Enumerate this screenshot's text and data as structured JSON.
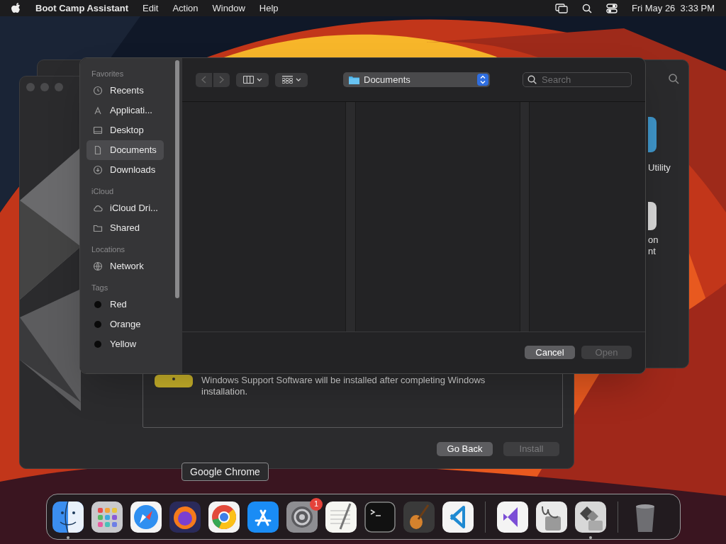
{
  "menu_bar": {
    "app_name": "Boot Camp Assistant",
    "menus": [
      "Edit",
      "Action",
      "Window",
      "Help"
    ],
    "clock": "Fri May 26  3:33 PM"
  },
  "back_window": {
    "labels": [
      "Utility",
      "on",
      "nt"
    ]
  },
  "boot_camp": {
    "message": "Windows Support Software will be installed after completing Windows installation.",
    "buttons": [
      {
        "label": "Go Back",
        "disabled": false
      },
      {
        "label": "Install",
        "disabled": true
      }
    ]
  },
  "open_dialog": {
    "sidebar": [
      {
        "title": "Favorites",
        "items": [
          {
            "label": "Recents",
            "kind": "clock",
            "selected": false
          },
          {
            "label": "Applicati...",
            "kind": "apps",
            "selected": false
          },
          {
            "label": "Desktop",
            "kind": "desktop",
            "selected": false
          },
          {
            "label": "Documents",
            "kind": "doc",
            "selected": true
          },
          {
            "label": "Downloads",
            "kind": "download",
            "selected": false
          }
        ]
      },
      {
        "title": "iCloud",
        "items": [
          {
            "label": "iCloud Dri...",
            "kind": "cloud",
            "selected": false
          },
          {
            "label": "Shared",
            "kind": "shared",
            "selected": false
          }
        ]
      },
      {
        "title": "Locations",
        "items": [
          {
            "label": "Network",
            "kind": "globe",
            "selected": false
          }
        ]
      },
      {
        "title": "Tags",
        "items": [
          {
            "label": "Red",
            "kind": "tag",
            "selected": false
          },
          {
            "label": "Orange",
            "kind": "tag",
            "selected": false
          },
          {
            "label": "Yellow",
            "kind": "tag",
            "selected": false
          }
        ]
      }
    ],
    "location": "Documents",
    "search_placeholder": "Search",
    "buttons": [
      {
        "label": "Cancel",
        "disabled": false
      },
      {
        "label": "Open",
        "disabled": true
      }
    ]
  },
  "dock": {
    "tooltip": "Google Chrome",
    "items": [
      {
        "kind": "finder",
        "running": true
      },
      {
        "kind": "launchpad",
        "running": false
      },
      {
        "kind": "safari",
        "running": false
      },
      {
        "kind": "firefox",
        "running": false
      },
      {
        "kind": "chrome",
        "running": false
      },
      {
        "kind": "appstore",
        "running": false
      },
      {
        "kind": "settings",
        "running": false,
        "badge": "1"
      },
      {
        "kind": "textedit",
        "running": false
      },
      {
        "kind": "terminal",
        "running": false
      },
      {
        "kind": "garageband",
        "running": false
      },
      {
        "kind": "vscode",
        "running": false
      },
      {
        "kind": "divider"
      },
      {
        "kind": "visualstudio",
        "running": false
      },
      {
        "kind": "diskutility",
        "running": false
      },
      {
        "kind": "bootcamp",
        "running": true
      },
      {
        "kind": "divider"
      },
      {
        "kind": "trash",
        "running": false
      }
    ]
  }
}
